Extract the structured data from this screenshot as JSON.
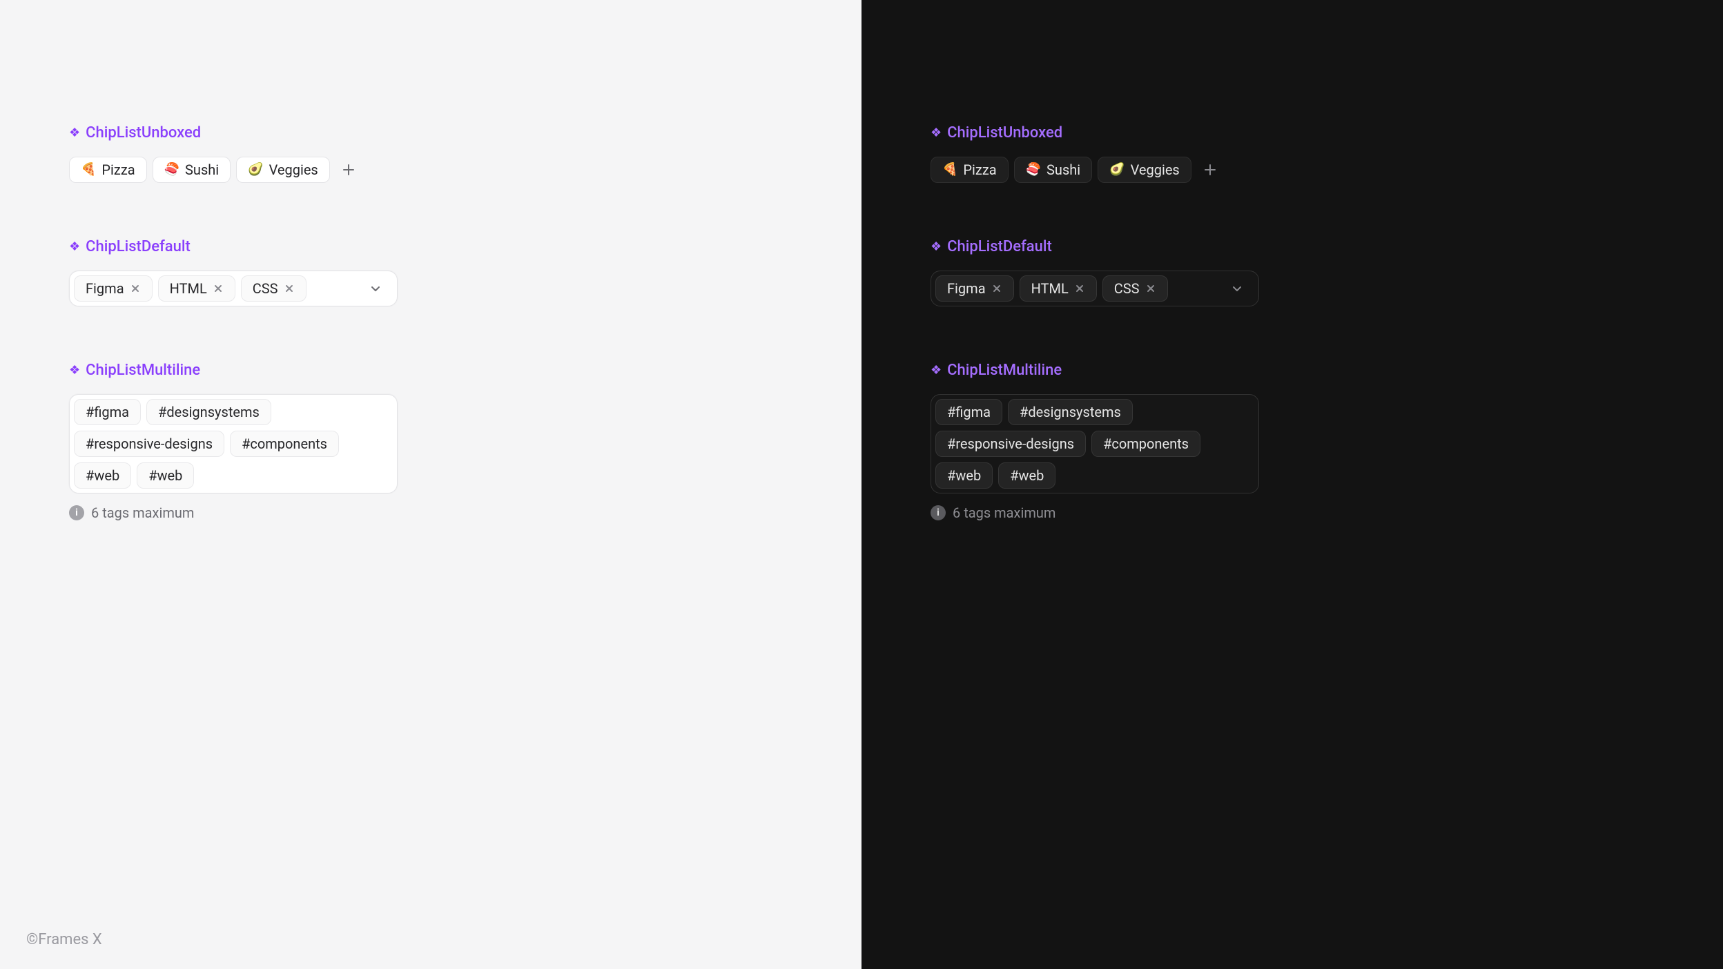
{
  "brand": "©Frames X",
  "sections": {
    "unboxed": {
      "title": "ChipListUnboxed",
      "chips": [
        {
          "emoji": "🍕",
          "label": "Pizza"
        },
        {
          "emoji": "🍣",
          "label": "Sushi"
        },
        {
          "emoji": "🥑",
          "label": "Veggies"
        }
      ]
    },
    "default": {
      "title": "ChipListDefault",
      "chips": [
        {
          "label": "Figma"
        },
        {
          "label": "HTML"
        },
        {
          "label": "CSS"
        }
      ]
    },
    "multiline": {
      "title": "ChipListMultiline",
      "chips": [
        {
          "label": "#figma"
        },
        {
          "label": "#designsystems"
        },
        {
          "label": "#responsive-designs"
        },
        {
          "label": "#components"
        },
        {
          "label": "#web"
        },
        {
          "label": "#web"
        }
      ],
      "helper": "6 tags maximum"
    }
  }
}
